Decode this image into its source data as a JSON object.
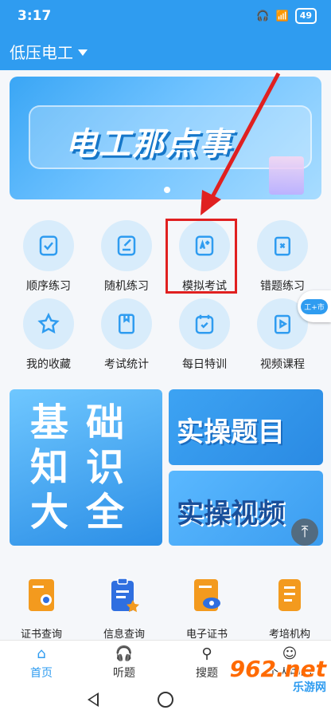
{
  "status": {
    "time": "3:17",
    "battery": "49"
  },
  "header": {
    "title": "低压电工"
  },
  "banner": {
    "text": "电工那点事"
  },
  "grid": {
    "row1": [
      "顺序练习",
      "随机练习",
      "模拟考试",
      "错题练习"
    ],
    "row2": [
      "我的收藏",
      "考试统计",
      "每日特训",
      "视频课程"
    ]
  },
  "side_badge": "工+市",
  "cards": {
    "big": [
      "基础",
      "知识",
      "大全"
    ],
    "practice": "实操题目",
    "video": "实操视频"
  },
  "services": [
    "证书查询",
    "信息查询",
    "电子证书",
    "考培机构"
  ],
  "tabs": [
    "首页",
    "听题",
    "搜题",
    "个人中心"
  ],
  "watermark": {
    "main": "962.net",
    "sub": "乐游网"
  },
  "colors": {
    "primary": "#2f9cf0",
    "highlight": "#e02020",
    "service_orange": "#f39a1e"
  }
}
